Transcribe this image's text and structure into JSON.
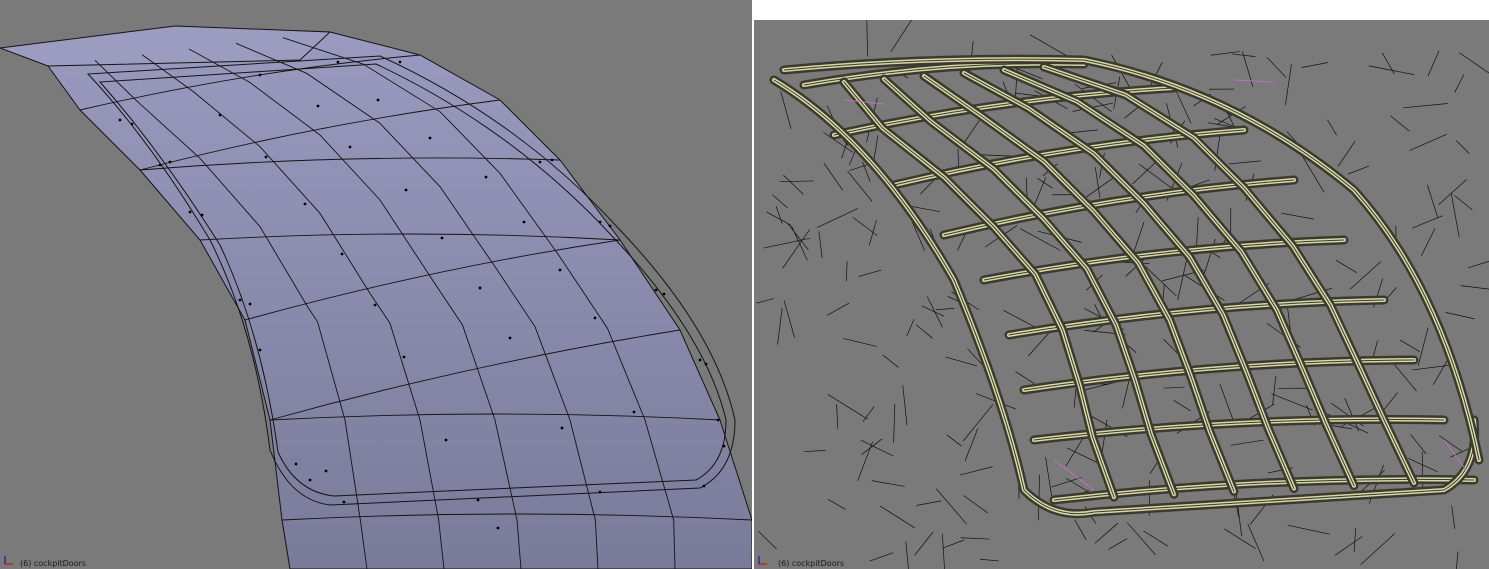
{
  "viewports": {
    "left": {
      "shading": "solid",
      "surface_color": "#7a7a99",
      "edge_color": "#141414",
      "vertex_color": "#000000",
      "background": "#7a7a7a",
      "object_label": "(6) cockpitDoors"
    },
    "right": {
      "shading": "wireframe-normals",
      "wire_color": "#3a3a2e",
      "highlight_color": "#d8d8a8",
      "normal_color": "#111111",
      "selection_color": "#c070c0",
      "background": "#7a7a7a",
      "object_label": "(6) cockpitDoors"
    }
  },
  "icons": {
    "axis": "axis-gizmo-icon"
  },
  "colors": {
    "axis_x": "#d00000",
    "axis_y": "#00a000",
    "axis_z": "#0000d0"
  }
}
